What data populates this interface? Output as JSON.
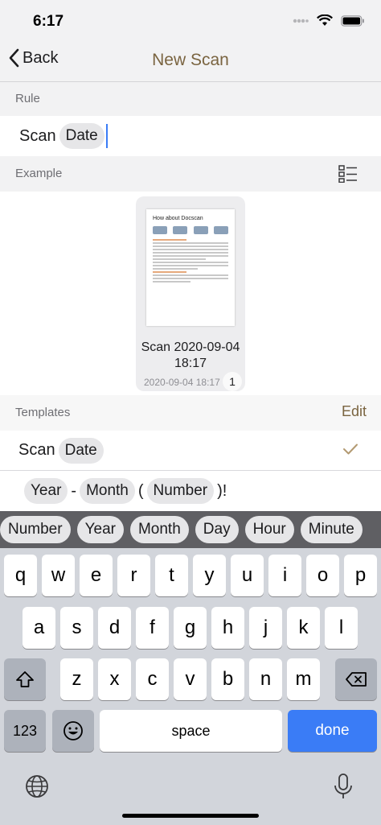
{
  "status": {
    "time": "6:17"
  },
  "nav": {
    "back_label": "Back",
    "title": "New Scan"
  },
  "rule": {
    "header": "Rule",
    "text": "Scan",
    "chip": "Date"
  },
  "example": {
    "header": "Example",
    "doc_title": "How about Docscan",
    "doc_name": "Scan 2020-09-04 18:17",
    "doc_date": "2020-09-04 18:17",
    "page_count": "1"
  },
  "templates": {
    "header": "Templates",
    "edit_label": "Edit",
    "row1": {
      "text": "Scan",
      "chip": "Date"
    },
    "row2": {
      "chip1": "Year",
      "sep1": "-",
      "chip2": "Month",
      "sep2": "(",
      "chip3": "Number",
      "sep3": ")!"
    }
  },
  "suggestions": [
    "Number",
    "Year",
    "Month",
    "Day",
    "Hour",
    "Minute"
  ],
  "keyboard": {
    "row1": [
      "q",
      "w",
      "e",
      "r",
      "t",
      "y",
      "u",
      "i",
      "o",
      "p"
    ],
    "row2": [
      "a",
      "s",
      "d",
      "f",
      "g",
      "h",
      "j",
      "k",
      "l"
    ],
    "row3": [
      "z",
      "x",
      "c",
      "v",
      "b",
      "n",
      "m"
    ],
    "numbers_label": "123",
    "space_label": "space",
    "done_label": "done"
  },
  "colors": {
    "accent": "#7a6440",
    "keyboard_done": "#3a7cf6",
    "caret": "#3a7cf6"
  }
}
